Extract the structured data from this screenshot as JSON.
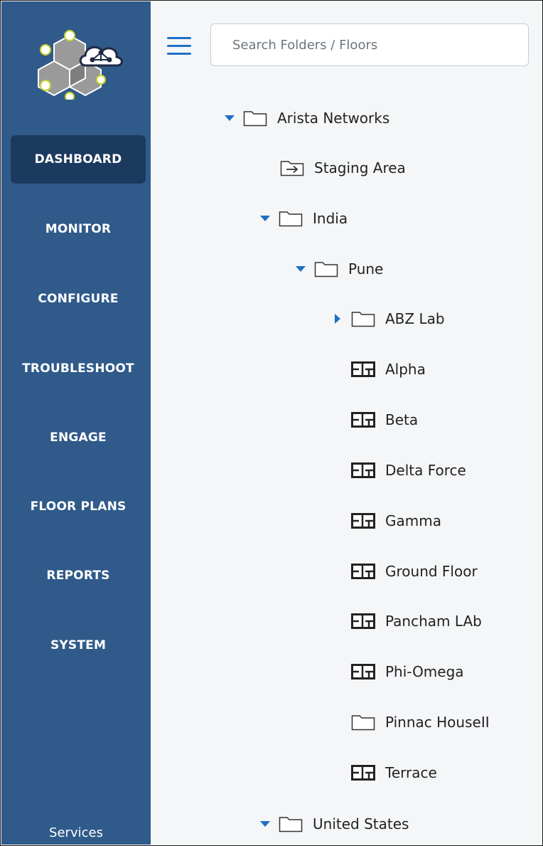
{
  "colors": {
    "sidebar": "#2f5a8a",
    "sidebar_active": "#1c3a5e",
    "accent": "#1f6fc5",
    "content_bg": "#f4f6f8"
  },
  "sidebar": {
    "items": [
      {
        "label": "DASHBOARD",
        "active": true
      },
      {
        "label": "MONITOR"
      },
      {
        "label": "CONFIGURE"
      },
      {
        "label": "TROUBLESHOOT"
      },
      {
        "label": "ENGAGE"
      },
      {
        "label": "FLOOR PLANS"
      },
      {
        "label": "REPORTS"
      },
      {
        "label": "SYSTEM"
      }
    ],
    "services_label": "Services"
  },
  "search": {
    "placeholder": "Search Folders / Floors",
    "value": ""
  },
  "tree": [
    {
      "label": "Arista Networks",
      "icon": "folder-icon",
      "expander": "expanded"
    },
    {
      "label": "Staging Area",
      "icon": "staging-folder-icon"
    },
    {
      "label": "India",
      "icon": "folder-icon",
      "expander": "expanded"
    },
    {
      "label": "Pune",
      "icon": "folder-icon",
      "expander": "expanded"
    },
    {
      "label": "ABZ Lab",
      "icon": "folder-icon",
      "expander": "collapsed"
    },
    {
      "label": "Alpha",
      "icon": "floor-plan-icon"
    },
    {
      "label": "Beta",
      "icon": "floor-plan-icon"
    },
    {
      "label": "Delta Force",
      "icon": "floor-plan-icon"
    },
    {
      "label": "Gamma",
      "icon": "floor-plan-icon"
    },
    {
      "label": "Ground Floor",
      "icon": "floor-plan-icon"
    },
    {
      "label": "Pancham LAb",
      "icon": "floor-plan-icon"
    },
    {
      "label": "Phi-Omega",
      "icon": "floor-plan-icon"
    },
    {
      "label": "Pinnac HouseII",
      "icon": "folder-icon"
    },
    {
      "label": "Terrace",
      "icon": "floor-plan-icon"
    },
    {
      "label": "United States",
      "icon": "folder-icon",
      "expander": "expanded"
    }
  ]
}
